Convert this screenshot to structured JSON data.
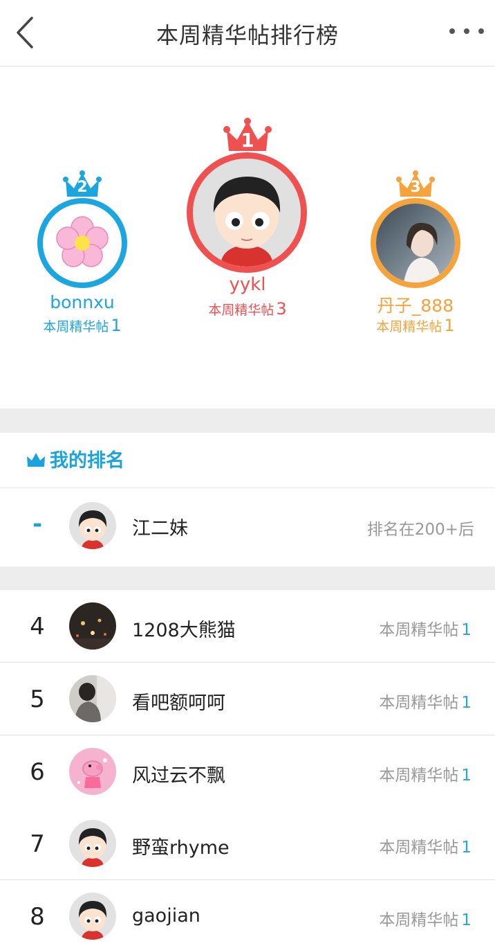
{
  "header": {
    "title": "本周精华帖排行榜"
  },
  "podium": [
    {
      "rank": "2",
      "name": "bonnxu",
      "label": "本周精华帖",
      "count": "1",
      "color": "#1ba6e0"
    },
    {
      "rank": "1",
      "name": "yykl",
      "label": "本周精华帖",
      "count": "3",
      "color": "#ef5050"
    },
    {
      "rank": "3",
      "name": "丹子_888",
      "label": "本周精华帖",
      "count": "1",
      "color": "#f5a33a"
    }
  ],
  "my_ranking": {
    "title": "我的排名",
    "rank": "-",
    "name": "江二妹",
    "status": "排名在200+后"
  },
  "list": [
    {
      "rank": "4",
      "name": "1208大熊猫",
      "label": "本周精华帖",
      "count": "1"
    },
    {
      "rank": "5",
      "name": "看吧额呵呵",
      "label": "本周精华帖",
      "count": "1"
    },
    {
      "rank": "6",
      "name": "风过云不飘",
      "label": "本周精华帖",
      "count": "1"
    },
    {
      "rank": "7",
      "name": "野蛮rhyme",
      "label": "本周精华帖",
      "count": "1"
    },
    {
      "rank": "8",
      "name": "gaojian",
      "label": "本周精华帖",
      "count": "1"
    }
  ]
}
